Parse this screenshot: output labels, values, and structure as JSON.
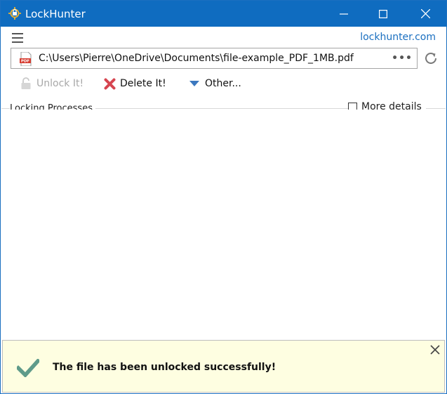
{
  "window": {
    "title": "LockHunter",
    "controls": [
      "minimize-icon",
      "maximize-icon",
      "close-icon"
    ]
  },
  "header": {
    "menu_icon": "hamburger-menu-icon",
    "site_link": "lockhunter.com"
  },
  "path_bar": {
    "file_icon": "pdf-file-icon",
    "path": "C:\\Users\\Pierre\\OneDrive\\Documents\\file-example_PDF_1MB.pdf",
    "more_label": "•••",
    "refresh_icon": "refresh-icon"
  },
  "toolbar": {
    "unlock_label": "Unlock It!",
    "unlock_icon": "padlock-icon",
    "unlock_enabled": false,
    "delete_label": "Delete It!",
    "delete_icon": "red-x-icon",
    "other_label": "Other...",
    "other_icon": "triangle-down-icon"
  },
  "processes": {
    "title": "Locking Processes",
    "more_details_label": "More details",
    "more_details_checked": false,
    "items": []
  },
  "notification": {
    "icon": "checkmark-icon",
    "message": "The file has been unlocked successfully!",
    "close_icon": "close-icon"
  },
  "colors": {
    "titlebar": "#0f6cc0",
    "link": "#1a6fc0",
    "notice_bg": "#fefee1",
    "check": "#5f9b8a",
    "delete_red": "#d64550",
    "other_arrow": "#3b78bf"
  }
}
